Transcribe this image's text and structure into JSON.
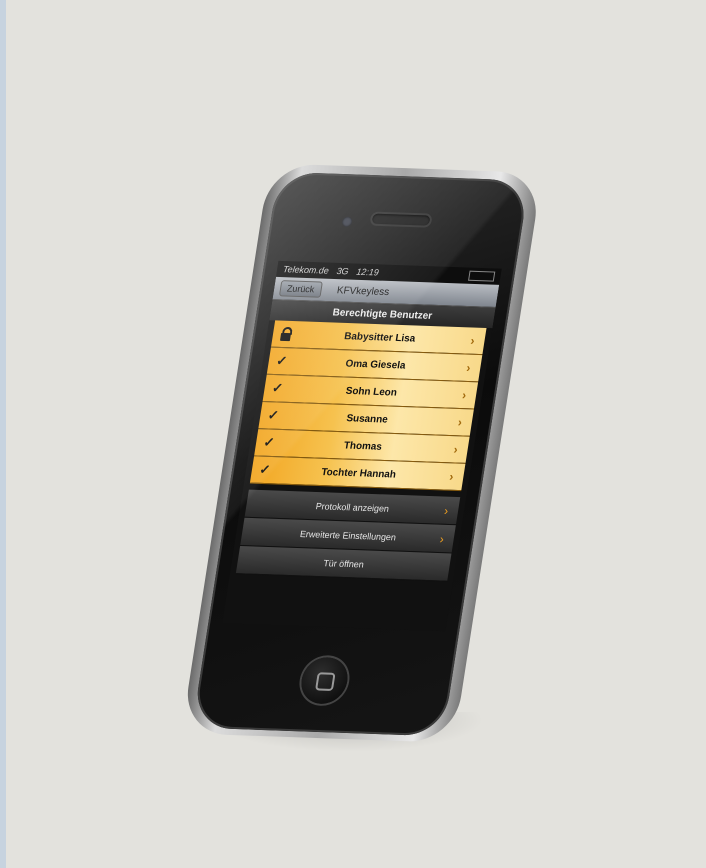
{
  "status_bar": {
    "carrier": "Telekom.de",
    "network": "3G",
    "time": "12:19"
  },
  "navbar": {
    "back_label": "Zurück",
    "title": "KFVkeyless"
  },
  "list": {
    "header": "Berechtigte Benutzer",
    "users": [
      {
        "name": "Babysitter Lisa",
        "icon": "lock-icon"
      },
      {
        "name": "Oma Giesela",
        "icon": "check-icon"
      },
      {
        "name": "Sohn Leon",
        "icon": "check-icon"
      },
      {
        "name": "Susanne",
        "icon": "check-icon"
      },
      {
        "name": "Thomas",
        "icon": "check-icon"
      },
      {
        "name": "Tochter Hannah",
        "icon": "check-icon"
      }
    ]
  },
  "actions": {
    "protocol": "Protokoll anzeigen",
    "settings": "Erweiterte Einstellungen",
    "open_door": "Tür öffnen"
  },
  "glyphs": {
    "check": "✓",
    "chevron": "›"
  },
  "colors": {
    "accent": "#f2a622",
    "background": "#e3e2dd"
  }
}
